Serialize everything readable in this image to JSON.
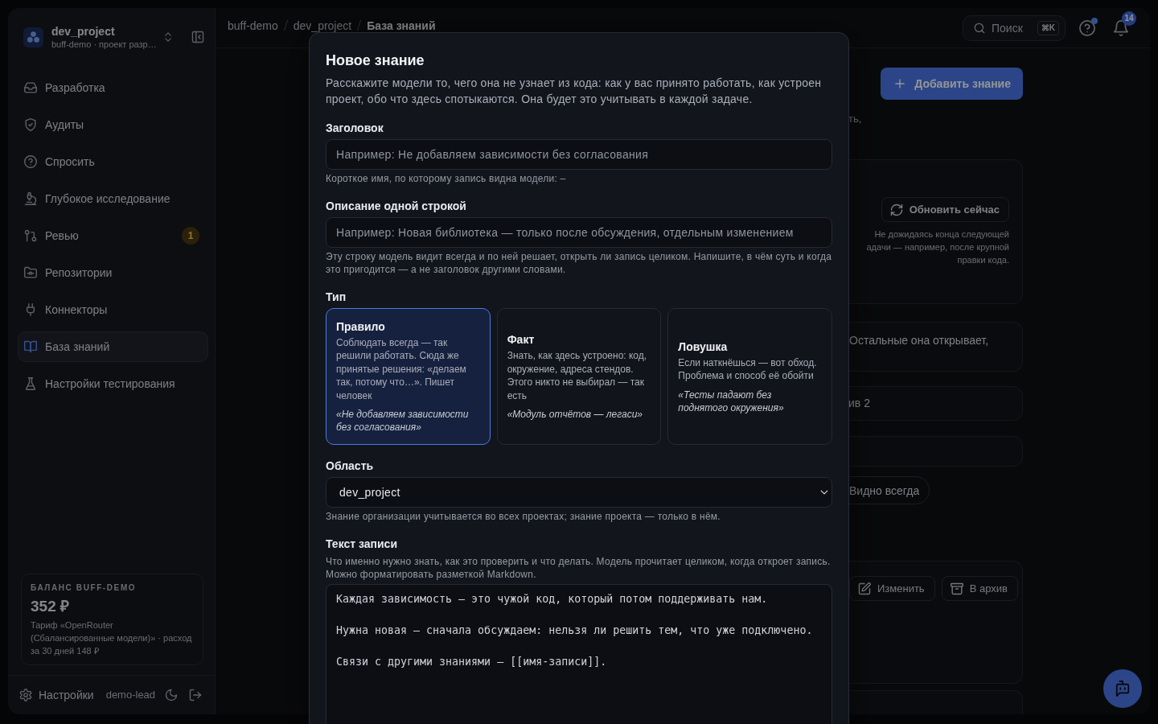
{
  "sidebar": {
    "project": {
      "name": "dev_project",
      "subtitle": "buff-demo · проект разр…"
    },
    "nav": [
      {
        "label": "Разработка",
        "selected": false
      },
      {
        "label": "Аудиты",
        "selected": false
      },
      {
        "label": "Спросить",
        "selected": false
      },
      {
        "label": "Глубокое исследование",
        "selected": false
      },
      {
        "label": "Ревью",
        "badge": "1",
        "selected": false
      },
      {
        "label": "Репозитории",
        "selected": false
      },
      {
        "label": "Коннекторы",
        "selected": false
      },
      {
        "label": "База знаний",
        "selected": true
      },
      {
        "label": "Настройки тестирования",
        "selected": false
      }
    ],
    "balance": {
      "title": "БАЛАНС BUFF-DEMO",
      "amount": "352 ₽",
      "note": "Тариф «OpenRouter (Сбалансированные модели)» · расход за 30 дней 148 ₽"
    },
    "footer": {
      "settings": "Настройки",
      "user": "demo-lead"
    }
  },
  "topbar": {
    "breadcrumbs": [
      {
        "label": "buff-demo",
        "current": false
      },
      {
        "label": "dev_project",
        "current": false
      },
      {
        "label": "База знаний",
        "current": true
      }
    ],
    "search": {
      "label": "Поиск",
      "shortcut": "⌘K"
    },
    "help": {
      "dot": true
    },
    "notifications": {
      "count": "14"
    }
  },
  "main": {
    "add_button": "Добавить знание",
    "intro_fragment": "ть,",
    "refresh": {
      "button": "Обновить сейчас",
      "note": "Не дожидаясь конца следующей\nадачи — например, после крупной\nправки кода."
    },
    "policy_fragment": "Остальные она открывает,",
    "archive_fragment": "ив 2",
    "visibility_chip": "Видно всегда",
    "actions": [
      {
        "label": "Изменить"
      },
      {
        "label": "В архив"
      }
    ]
  },
  "modal": {
    "title": "Новое знание",
    "description": "Расскажите модели то, чего она не узнает из кода: как у вас принято работать, как устроен проект, обо что здесь спотыкаются. Она будет это учитывать в каждой задаче.",
    "fields": [
      {
        "kind": "text",
        "label": "Заголовок",
        "placeholder": "Например: Не добавляем зависимости без согласования",
        "hint": "Короткое имя, по которому запись видна модели: –"
      },
      {
        "kind": "text",
        "label": "Описание одной строкой",
        "placeholder": "Например: Новая библиотека — только после обсуждения, отдельным изменением",
        "hint": "Эту строку модель видит всегда и по ней решает, открыть ли запись целиком. Напишите, в чём суть и когда это пригодится — а не заголовок другими словами."
      },
      {
        "kind": "choice",
        "label": "Тип",
        "options": [
          {
            "title": "Правило",
            "description": "Соблюдать всегда — так решили работать. Сюда же принятые решения: «делаем так, потому что…». Пишет человек",
            "example": "«Не добавляем зависимости без согласования»",
            "selected": true
          },
          {
            "title": "Факт",
            "description": "Знать, как здесь устроено: код, окружение, адреса стендов. Этого никто не выбирал — так есть",
            "example": "«Модуль отчётов — легаси»",
            "selected": false
          },
          {
            "title": "Ловушка",
            "description": "Если наткнёшься — вот обход. Проблема и способ её обойти",
            "example": "«Тесты падают без поднятого окружения»",
            "selected": false
          }
        ]
      },
      {
        "kind": "select",
        "label": "Область",
        "value": "dev_project",
        "hint": "Знание организации учитывается во всех проектах; знание проекта — только в нём."
      },
      {
        "kind": "textarea",
        "label": "Текст записи",
        "hint": "Что именно нужно знать, как это проверить и что делать. Модель прочитает целиком, когда откроет запись. Можно форматировать разметкой Markdown.",
        "value": "Каждая зависимость — это чужой код, который потом поддерживать нам.\n\nНужна новая — сначала обсуждаем: нельзя ли решить тем, что уже подключено.\n\nСвязи с другими знаниями — [[имя-записи]]."
      }
    ]
  }
}
